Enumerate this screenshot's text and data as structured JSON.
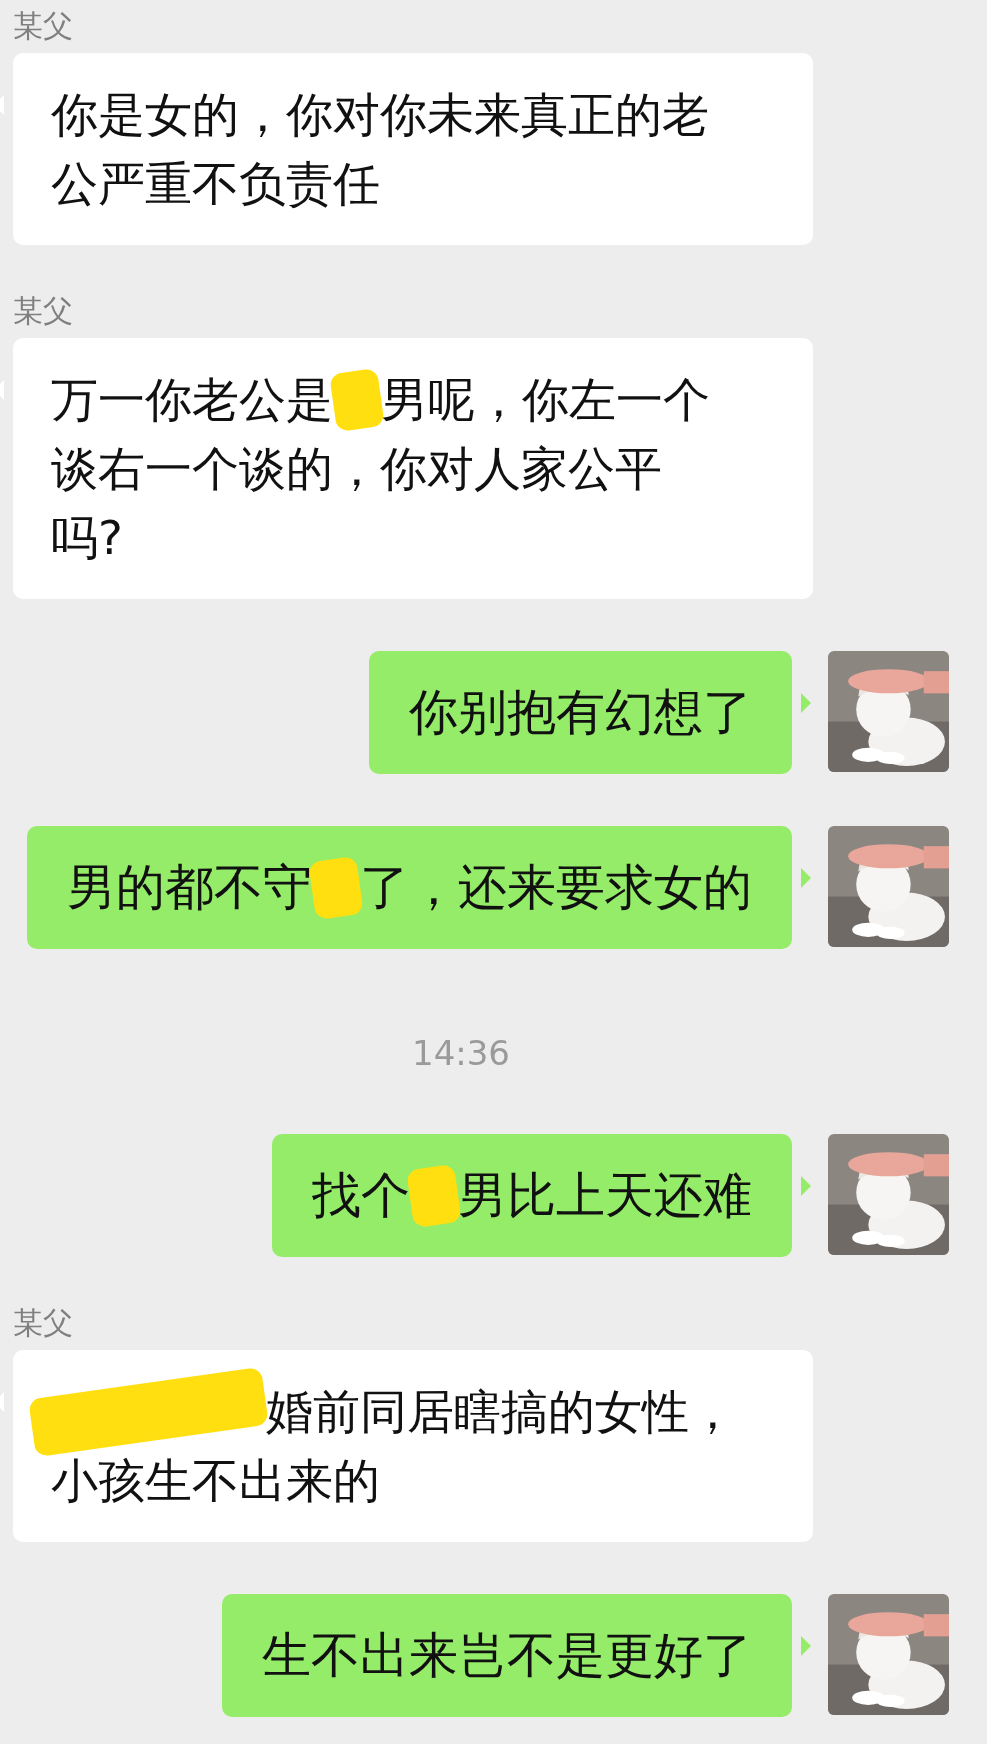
{
  "chat": [
    {
      "kind": "name",
      "text": "某父"
    },
    {
      "kind": "incoming",
      "lines": [
        [
          {
            "kind": "text",
            "text": "你是女的，你对你未来真正的老"
          }
        ],
        [
          {
            "kind": "text",
            "text": "公严重不负责任"
          }
        ]
      ]
    },
    {
      "kind": "name",
      "text": "某父"
    },
    {
      "kind": "incoming",
      "lines": [
        [
          {
            "kind": "text",
            "text": "万一你老公是"
          },
          {
            "kind": "redaction"
          },
          {
            "kind": "text",
            "text": "男呢，你左一个"
          }
        ],
        [
          {
            "kind": "text",
            "text": "谈右一个谈的，你对人家公平"
          }
        ],
        [
          {
            "kind": "text",
            "text": "吗?"
          }
        ]
      ]
    },
    {
      "kind": "outgoing",
      "lines": [
        [
          {
            "kind": "text",
            "text": "你别抱有幻想了"
          }
        ]
      ]
    },
    {
      "kind": "outgoing",
      "lines": [
        [
          {
            "kind": "text",
            "text": "男的都不守"
          },
          {
            "kind": "redaction"
          },
          {
            "kind": "text",
            "text": "了，还来要求女的"
          }
        ]
      ]
    },
    {
      "kind": "time",
      "text": "14:36"
    },
    {
      "kind": "outgoing",
      "lines": [
        [
          {
            "kind": "text",
            "text": "找个"
          },
          {
            "kind": "redaction"
          },
          {
            "kind": "text",
            "text": "男比上天还难"
          }
        ]
      ]
    },
    {
      "kind": "name",
      "text": "某父"
    },
    {
      "kind": "incoming",
      "lines": [
        [
          {
            "kind": "wide_redaction"
          },
          {
            "kind": "text",
            "text": "婚前同居瞎搞的女性，"
          }
        ],
        [
          {
            "kind": "text",
            "text": "小孩生不出来的"
          }
        ]
      ]
    },
    {
      "kind": "outgoing",
      "lines": [
        [
          {
            "kind": "text",
            "text": "生不出来岂不是更好了"
          }
        ]
      ]
    }
  ]
}
